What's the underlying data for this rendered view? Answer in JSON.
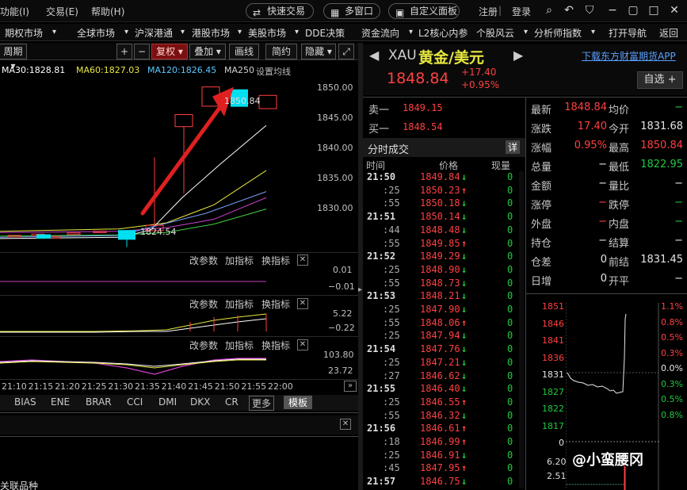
{
  "menubar": {
    "items": [
      "功能(I)",
      "交易(E)",
      "帮助(H)"
    ],
    "pills": [
      "快速交易",
      "多窗口",
      "自定义面板"
    ],
    "login": [
      "注册",
      "登录"
    ]
  },
  "navbar": {
    "items": [
      "期权市场",
      "全球市场",
      "沪深港通",
      "港股市场",
      "美股市场",
      "DDE决策",
      "资金流向",
      "L2核心内参",
      "个股风云",
      "分析师指数",
      "打开导航",
      "返回"
    ]
  },
  "chart_toolbar": {
    "period": "周期",
    "plus": "+",
    "minus": "−",
    "fq": "复权",
    "overlay": "叠加",
    "draw": "画线",
    "simple": "简约",
    "hide": "隐藏"
  },
  "ma_legend": {
    "ma30": "MA30:1828.81",
    "ma60": "MA60:1827.03",
    "ma120": "MA120:1826.45",
    "ma250": "MA250",
    "setting": "设置均线"
  },
  "colors": {
    "up": "#ff4040",
    "down": "#20c840",
    "ma30": "#ffffff",
    "ma60": "#e8e840",
    "ma120": "#d040d0",
    "ma250": "#40d040",
    "accent_candle": "#00e0f0"
  },
  "chart_data": {
    "type": "candlestick",
    "y_ticks": [
      "1850.00",
      "1845.00",
      "1840.00",
      "1835.00",
      "1830.00"
    ],
    "ylim": [
      1823,
      1852
    ],
    "high_label": "1850.84",
    "low_label": "1824.54",
    "x_ticks": [
      "21:10",
      "21:15",
      "21:20",
      "21:25",
      "21:30",
      "21:35",
      "21:40",
      "21:45",
      "21:50",
      "21:55",
      "22:00"
    ]
  },
  "subpanels": [
    {
      "param": "改参数",
      "add": "加指标",
      "swap": "换指标",
      "ticks": [
        "0.01",
        "−0.01"
      ]
    },
    {
      "param": "改参数",
      "add": "加指标",
      "swap": "换指标",
      "ticks": [
        "5.22",
        "−0.22"
      ]
    },
    {
      "param": "改参数",
      "add": "加指标",
      "swap": "换指标",
      "ticks": [
        "103.80",
        "23.72"
      ]
    }
  ],
  "indicator_tabs": [
    "BIAS",
    "ENE",
    "BRAR",
    "CCI",
    "DMI",
    "DKX",
    "CR",
    "更多",
    "模板"
  ],
  "bottom_text": "关联品种",
  "quote": {
    "code": "XAU",
    "name": "黄金/美元",
    "price": "1848.84",
    "change": "+17.40",
    "change_pct": "+0.95%",
    "download": "下载东方财富期货APP",
    "watch": "自选",
    "sell1_label": "卖一",
    "sell1": "1849.15",
    "buy1_label": "买一",
    "buy1": "1848.54"
  },
  "stats": {
    "rows": [
      {
        "l1": "最新",
        "v1": "1848.84",
        "c1": "red",
        "l2": "均价",
        "v2": "−",
        "c2": "green"
      },
      {
        "l1": "涨跌",
        "v1": "17.40",
        "c1": "red",
        "l2": "今开",
        "v2": "1831.68",
        "c2": "white"
      },
      {
        "l1": "涨幅",
        "v1": "0.95%",
        "c1": "red",
        "l2": "最高",
        "v2": "1850.84",
        "c2": "red"
      },
      {
        "l1": "总量",
        "v1": "−",
        "c1": "white",
        "l2": "最低",
        "v2": "1822.95",
        "c2": "green"
      },
      {
        "l1": "金额",
        "v1": "−",
        "c1": "white",
        "l2": "量比",
        "v2": "−",
        "c2": "white"
      },
      {
        "l1": "涨停",
        "v1": "−",
        "c1": "red",
        "l2": "跌停",
        "v2": "−",
        "c2": "green"
      },
      {
        "l1": "外盘",
        "v1": "−",
        "c1": "red",
        "l2": "内盘",
        "v2": "−",
        "c2": "green"
      },
      {
        "l1": "持仓",
        "v1": "−",
        "c1": "white",
        "l2": "结算",
        "v2": "−",
        "c2": "white"
      },
      {
        "l1": "仓差",
        "v1": "0",
        "c1": "white",
        "l2": "前结",
        "v2": "1831.45",
        "c2": "white"
      },
      {
        "l1": "日增",
        "v1": "0",
        "c1": "white",
        "l2": "开平",
        "v2": "−",
        "c2": "white"
      }
    ]
  },
  "trades": {
    "title": "分时成交",
    "detail": "详",
    "headers": [
      "时间",
      "价格",
      "现量"
    ],
    "rows": [
      {
        "t": "21:50",
        "p": "1849.84",
        "d": "down",
        "v": "0"
      },
      {
        "t": ":25",
        "p": "1850.23",
        "d": "up",
        "v": "0"
      },
      {
        "t": ":55",
        "p": "1850.18",
        "d": "down",
        "v": "0"
      },
      {
        "t": "21:51",
        "p": "1850.14",
        "d": "down",
        "v": "0"
      },
      {
        "t": ":44",
        "p": "1848.48",
        "d": "down",
        "v": "0"
      },
      {
        "t": ":55",
        "p": "1849.85",
        "d": "up",
        "v": "0"
      },
      {
        "t": "21:52",
        "p": "1849.29",
        "d": "down",
        "v": "0"
      },
      {
        "t": ":25",
        "p": "1848.90",
        "d": "down",
        "v": "0"
      },
      {
        "t": ":55",
        "p": "1848.73",
        "d": "down",
        "v": "0"
      },
      {
        "t": "21:53",
        "p": "1848.21",
        "d": "down",
        "v": "0"
      },
      {
        "t": ":25",
        "p": "1847.90",
        "d": "down",
        "v": "0"
      },
      {
        "t": ":55",
        "p": "1848.06",
        "d": "up",
        "v": "0"
      },
      {
        "t": ":25",
        "p": "1847.94",
        "d": "down",
        "v": "0"
      },
      {
        "t": "21:54",
        "p": "1847.76",
        "d": "down",
        "v": "0"
      },
      {
        "t": ":25",
        "p": "1847.21",
        "d": "down",
        "v": "0"
      },
      {
        "t": ":27",
        "p": "1846.62",
        "d": "down",
        "v": "0"
      },
      {
        "t": "21:55",
        "p": "1846.40",
        "d": "down",
        "v": "0"
      },
      {
        "t": ":25",
        "p": "1846.55",
        "d": "up",
        "v": "0"
      },
      {
        "t": ":55",
        "p": "1846.32",
        "d": "down",
        "v": "0"
      },
      {
        "t": "21:56",
        "p": "1846.61",
        "d": "up",
        "v": "0"
      },
      {
        "t": ":18",
        "p": "1846.99",
        "d": "up",
        "v": "0"
      },
      {
        "t": ":25",
        "p": "1846.91",
        "d": "down",
        "v": "0"
      },
      {
        "t": ":45",
        "p": "1847.95",
        "d": "up",
        "v": "0"
      },
      {
        "t": "21:57",
        "p": "1846.75",
        "d": "down",
        "v": "0"
      }
    ]
  },
  "mini_chart": {
    "left_ticks": [
      "1851",
      "1846",
      "1841",
      "1836",
      "1831",
      "1827",
      "1822",
      "1817",
      "0"
    ],
    "right_ticks": [
      "1.1%",
      "0.8%",
      "0.5%",
      "0.3%",
      "0.0%",
      "0.3%",
      "0.5%",
      "0.8%"
    ],
    "vol_ticks": [
      "6.20",
      "2.51"
    ]
  },
  "watermark": "@小蛮腰冈"
}
